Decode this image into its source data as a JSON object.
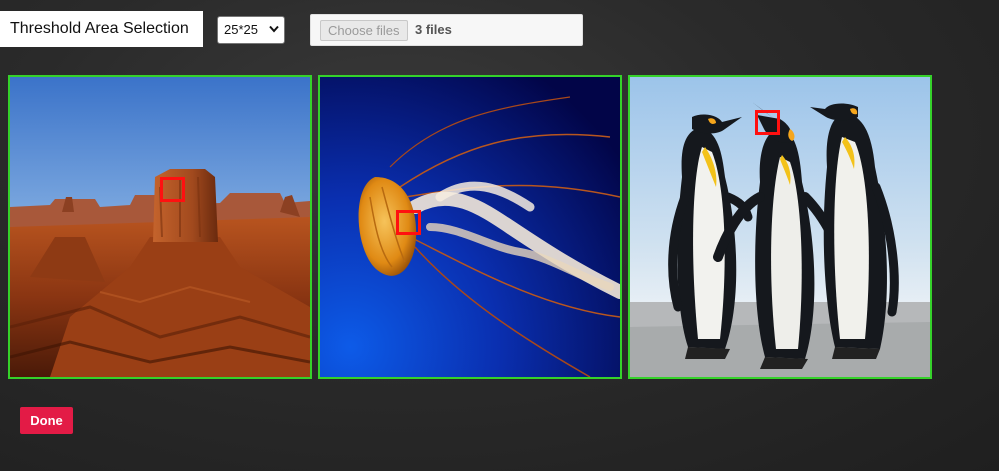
{
  "header": {
    "title": "Threshold Area Selection",
    "size_select": {
      "selected": "25*25"
    },
    "file_input": {
      "button_label": "Choose files",
      "status": "3 files"
    }
  },
  "images": [
    {
      "subject": "desert-butte"
    },
    {
      "subject": "jellyfish"
    },
    {
      "subject": "penguins"
    }
  ],
  "actions": {
    "done_label": "Done"
  },
  "colors": {
    "thumb_border": "#35d22a",
    "selection_box": "#ff1010",
    "done_button": "#e31b46"
  }
}
